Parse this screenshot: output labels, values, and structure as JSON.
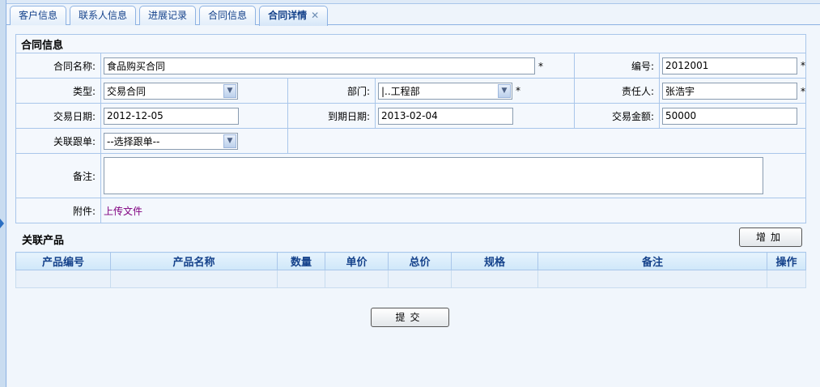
{
  "tabs": [
    {
      "label": "客户信息"
    },
    {
      "label": "联系人信息"
    },
    {
      "label": "进展记录"
    },
    {
      "label": "合同信息"
    },
    {
      "label": "合同详情",
      "active": true,
      "close": "✕"
    }
  ],
  "form": {
    "title": "合同信息",
    "name_label": "合同名称:",
    "name_value": "食品购买合同",
    "number_label": "编号:",
    "number_value": "2012001",
    "type_label": "类型:",
    "type_value": "交易合同",
    "dept_label": "部门:",
    "dept_value": "|..工程部",
    "owner_label": "责任人:",
    "owner_value": "张浩宇",
    "trade_date_label": "交易日期:",
    "trade_date_value": "2012-12-05",
    "due_date_label": "到期日期:",
    "due_date_value": "2013-02-04",
    "amount_label": "交易金额:",
    "amount_value": "50000",
    "related_label": "关联跟单:",
    "related_value": "--选择跟单--",
    "remark_label": "备注:",
    "remark_value": "",
    "attach_label": "附件:",
    "attach_link": "上传文件",
    "required": "*"
  },
  "products": {
    "title": "关联产品",
    "add_button": "增加",
    "columns": [
      "产品编号",
      "产品名称",
      "数量",
      "单价",
      "总价",
      "规格",
      "备注",
      "操作"
    ]
  },
  "submit_button": "提交"
}
